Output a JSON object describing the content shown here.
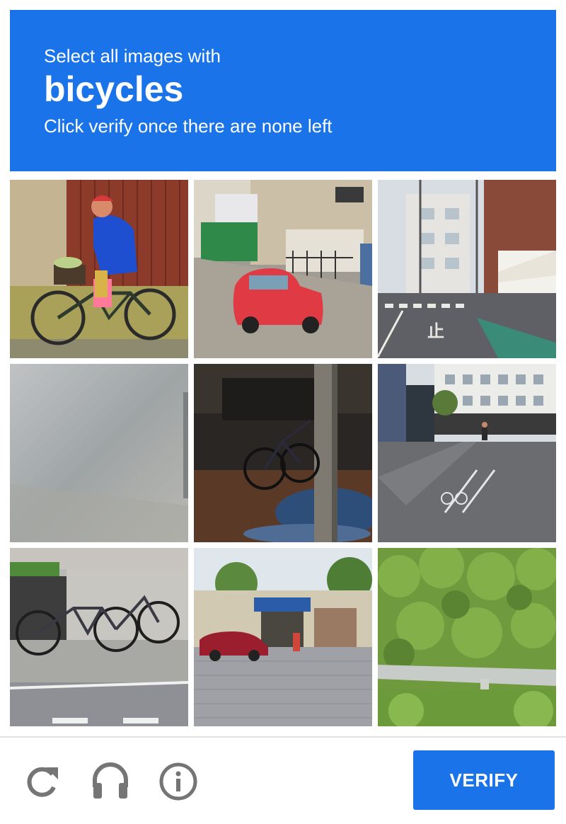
{
  "header": {
    "instruction_line1": "Select all images with",
    "target_object": "bicycles",
    "instruction_line3": "Click verify once there are none left",
    "background_color": "#1a73e8"
  },
  "grid": {
    "rows": 3,
    "columns": 3,
    "tiles": [
      {
        "scene": "woman in blue shirt riding bicycle by red wall"
      },
      {
        "scene": "red car parked on street by buildings"
      },
      {
        "scene": "japanese street with crosswalk and shop"
      },
      {
        "scene": "blurry foggy gray image"
      },
      {
        "scene": "dark room with bicycle and post"
      },
      {
        "scene": "city street with cyclist and bike lane"
      },
      {
        "scene": "parked bicycles on sidewalk"
      },
      {
        "scene": "street with red car and shops"
      },
      {
        "scene": "green bushes and guard rail"
      }
    ]
  },
  "footer": {
    "reload_icon": "reload-icon",
    "audio_icon": "headphones-icon",
    "info_icon": "info-icon",
    "verify_label": "VERIFY",
    "icon_color": "#757575",
    "button_color": "#1a73e8"
  }
}
